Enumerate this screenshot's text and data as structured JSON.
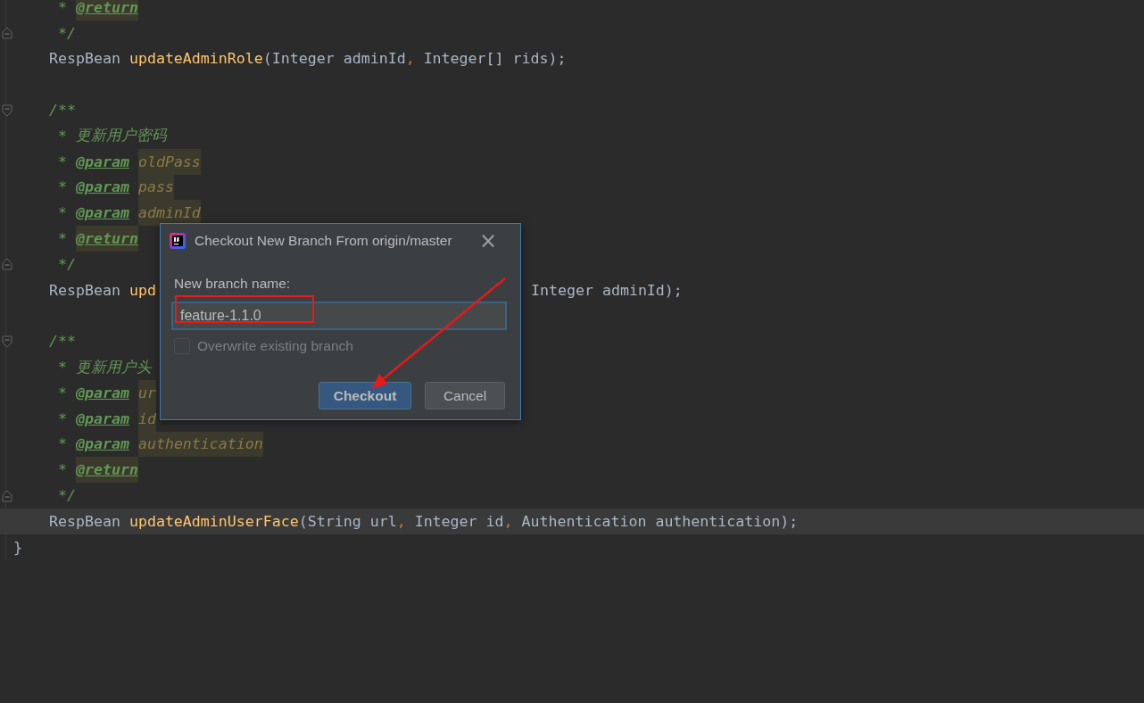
{
  "editor": {
    "lines": [
      {
        "kind": "doc",
        "current": false,
        "tokens": [
          {
            "kind": "star",
            "text": "*"
          },
          {
            "kind": "tag",
            "text": "@return",
            "marked": true
          }
        ]
      },
      {
        "kind": "doc",
        "fold_end": true,
        "current": false,
        "tokens": [
          {
            "kind": "doc",
            "text": "*/"
          }
        ]
      },
      {
        "kind": "code",
        "current": false,
        "tokens": [
          {
            "kind": "plain",
            "text": "RespBean"
          },
          {
            "kind": "method",
            "text": "updateAdminRole"
          },
          {
            "kind": "plain",
            "text": "(Integer adminId"
          },
          {
            "kind": "punct",
            "text": ","
          },
          {
            "kind": "plain",
            "text": "Integer[] rids);"
          }
        ]
      },
      {
        "current": false
      },
      {
        "kind": "code",
        "fold_start": true,
        "current": false,
        "tokens": [
          {
            "kind": "doc",
            "text": "/**"
          }
        ]
      },
      {
        "kind": "doc",
        "current": false,
        "tokens": [
          {
            "kind": "star",
            "text": "*"
          },
          {
            "kind": "doc",
            "text": "更新用户密码"
          }
        ]
      },
      {
        "kind": "doc",
        "current": false,
        "tokens": [
          {
            "kind": "star",
            "text": "*"
          },
          {
            "kind": "tag",
            "text": "@param",
            "marked": false
          },
          {
            "kind": "ref",
            "text": "oldPass"
          }
        ]
      },
      {
        "kind": "doc",
        "current": false,
        "tokens": [
          {
            "kind": "star",
            "text": "*"
          },
          {
            "kind": "tag",
            "text": "@param",
            "marked": false
          },
          {
            "kind": "ref",
            "text": "pass"
          }
        ]
      },
      {
        "kind": "doc",
        "current": false,
        "tokens": [
          {
            "kind": "star",
            "text": "*"
          },
          {
            "kind": "tag",
            "text": "@param",
            "marked": false
          },
          {
            "kind": "ref",
            "text": "adminId"
          }
        ]
      },
      {
        "kind": "doc",
        "current": false,
        "tokens": [
          {
            "kind": "star",
            "text": "*"
          },
          {
            "kind": "tag",
            "text": "@return",
            "marked": true
          }
        ]
      },
      {
        "kind": "doc",
        "fold_end": true,
        "current": false,
        "tokens": [
          {
            "kind": "doc",
            "text": "*/"
          }
        ]
      },
      {
        "kind": "code",
        "current": false,
        "tokens": [
          {
            "kind": "plain",
            "text": "RespBean"
          },
          {
            "kind": "method",
            "text": "upd"
          }
        ],
        "tail": [
          {
            "kind": "plain",
            "text": "Integer adminId);"
          }
        ]
      },
      {
        "current": false
      },
      {
        "kind": "code",
        "fold_start": true,
        "current": false,
        "tokens": [
          {
            "kind": "doc",
            "text": "/**"
          }
        ]
      },
      {
        "kind": "doc",
        "current": false,
        "tokens": [
          {
            "kind": "star",
            "text": "*"
          },
          {
            "kind": "doc",
            "text": "更新用户头"
          }
        ]
      },
      {
        "kind": "doc",
        "current": false,
        "tokens": [
          {
            "kind": "star",
            "text": "*"
          },
          {
            "kind": "tag",
            "text": "@param",
            "marked": false
          },
          {
            "kind": "ref",
            "text": "ur"
          }
        ]
      },
      {
        "kind": "doc",
        "current": false,
        "tokens": [
          {
            "kind": "star",
            "text": "*"
          },
          {
            "kind": "tag",
            "text": "@param",
            "marked": false
          },
          {
            "kind": "ref",
            "text": "id"
          }
        ]
      },
      {
        "kind": "doc",
        "current": false,
        "tokens": [
          {
            "kind": "star",
            "text": "*"
          },
          {
            "kind": "tag",
            "text": "@param",
            "marked": false
          },
          {
            "kind": "ref",
            "text": "authentication"
          }
        ]
      },
      {
        "kind": "doc",
        "current": false,
        "tokens": [
          {
            "kind": "star",
            "text": "*"
          },
          {
            "kind": "tag",
            "text": "@return",
            "marked": true
          }
        ]
      },
      {
        "kind": "doc",
        "fold_end": true,
        "current": false,
        "tokens": [
          {
            "kind": "doc",
            "text": "*/"
          }
        ]
      },
      {
        "kind": "code",
        "current": true,
        "tokens": [
          {
            "kind": "plain",
            "text": "RespBean"
          },
          {
            "kind": "method",
            "text": "updateAdminUserFace"
          },
          {
            "kind": "plain",
            "text": "(String url"
          },
          {
            "kind": "punct",
            "text": ","
          },
          {
            "kind": "plain",
            "text": "Integer id"
          },
          {
            "kind": "punct",
            "text": ","
          },
          {
            "kind": "plain",
            "text": "Authentication authentication);"
          }
        ]
      },
      {
        "kind": "top",
        "current": false,
        "tokens": [
          {
            "kind": "plain",
            "text": "}"
          }
        ]
      }
    ]
  },
  "dialog": {
    "title": "Checkout New Branch From origin/master",
    "close": "×",
    "label": "New branch name:",
    "value": "feature-1.1.0",
    "checkbox": {
      "label": "Overwrite existing branch",
      "checked": false,
      "disabled": true
    },
    "buttons": [
      {
        "label": "Checkout",
        "default": true
      },
      {
        "label": "Cancel",
        "default": false
      }
    ]
  }
}
